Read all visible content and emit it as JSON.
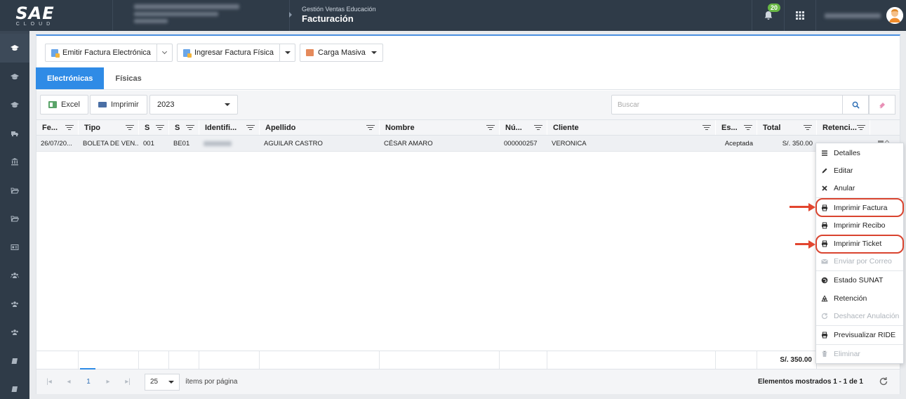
{
  "brand": {
    "logo_text": "SAE",
    "logo_sub": "CLOUD"
  },
  "header": {
    "context_sub": "Gestión Ventas Educación",
    "context_title": "Facturación",
    "notifications_count": "20"
  },
  "actions": {
    "emitir": "Emitir Factura Electrónica",
    "ingresar": "Ingresar Factura Física",
    "carga": "Carga Masiva"
  },
  "tabs": [
    {
      "label": "Electrónicas",
      "active": true
    },
    {
      "label": "Físicas",
      "active": false
    }
  ],
  "toolbar": {
    "excel": "Excel",
    "imprimir": "Imprimir",
    "year": "2023",
    "search_placeholder": "Buscar"
  },
  "columns": [
    "Fe...",
    "Tipo",
    "S",
    "S",
    "Identifi...",
    "Apellido",
    "Nombre",
    "Nú...",
    "Cliente",
    "Es...",
    "Total",
    "Retenci..."
  ],
  "rows": [
    {
      "fecha": "26/07/20...",
      "tipo": "BOLETA DE VEN...",
      "serie1": "001",
      "serie2": "BE01",
      "apellido": "AGUILAR CASTRO",
      "nombre": "CÉSAR AMARO",
      "numero": "000000257",
      "cliente": "VERONICA",
      "estado": "Aceptada",
      "total": "S/. 350.00"
    }
  ],
  "footer_total": "S/. 350.00",
  "pager": {
    "current_page": "1",
    "page_size": "25",
    "page_size_label": "ítems por página",
    "info": "Elementos mostrados 1 - 1 de 1"
  },
  "context_menu": [
    {
      "label": "Detalles",
      "icon": "list-icon",
      "disabled": false
    },
    {
      "label": "Editar",
      "icon": "pencil-icon",
      "disabled": false
    },
    {
      "label": "Anular",
      "icon": "x-icon",
      "disabled": false
    },
    {
      "label": "Imprimir Factura",
      "icon": "printer-icon",
      "disabled": false,
      "highlighted": true
    },
    {
      "label": "Imprimir Recibo",
      "icon": "printer-icon",
      "disabled": false
    },
    {
      "label": "Imprimir Ticket",
      "icon": "printer-icon",
      "disabled": false,
      "highlighted": true
    },
    {
      "label": "Enviar por Correo",
      "icon": "envelope-icon",
      "disabled": true
    },
    {
      "label": "Estado SUNAT",
      "icon": "globe-icon",
      "disabled": false
    },
    {
      "label": "Retención",
      "icon": "recycle-icon",
      "disabled": false
    },
    {
      "label": "Deshacer Anulación",
      "icon": "undo-icon",
      "disabled": true
    },
    {
      "label": "Previsualizar RIDE",
      "icon": "printer-icon",
      "disabled": false
    },
    {
      "label": "Eliminar",
      "icon": "trash-icon",
      "disabled": true
    }
  ],
  "colors": {
    "accent": "#2f8be6",
    "topbar": "#2f3b48",
    "highlight": "#d9442f",
    "badge": "#69b845"
  }
}
